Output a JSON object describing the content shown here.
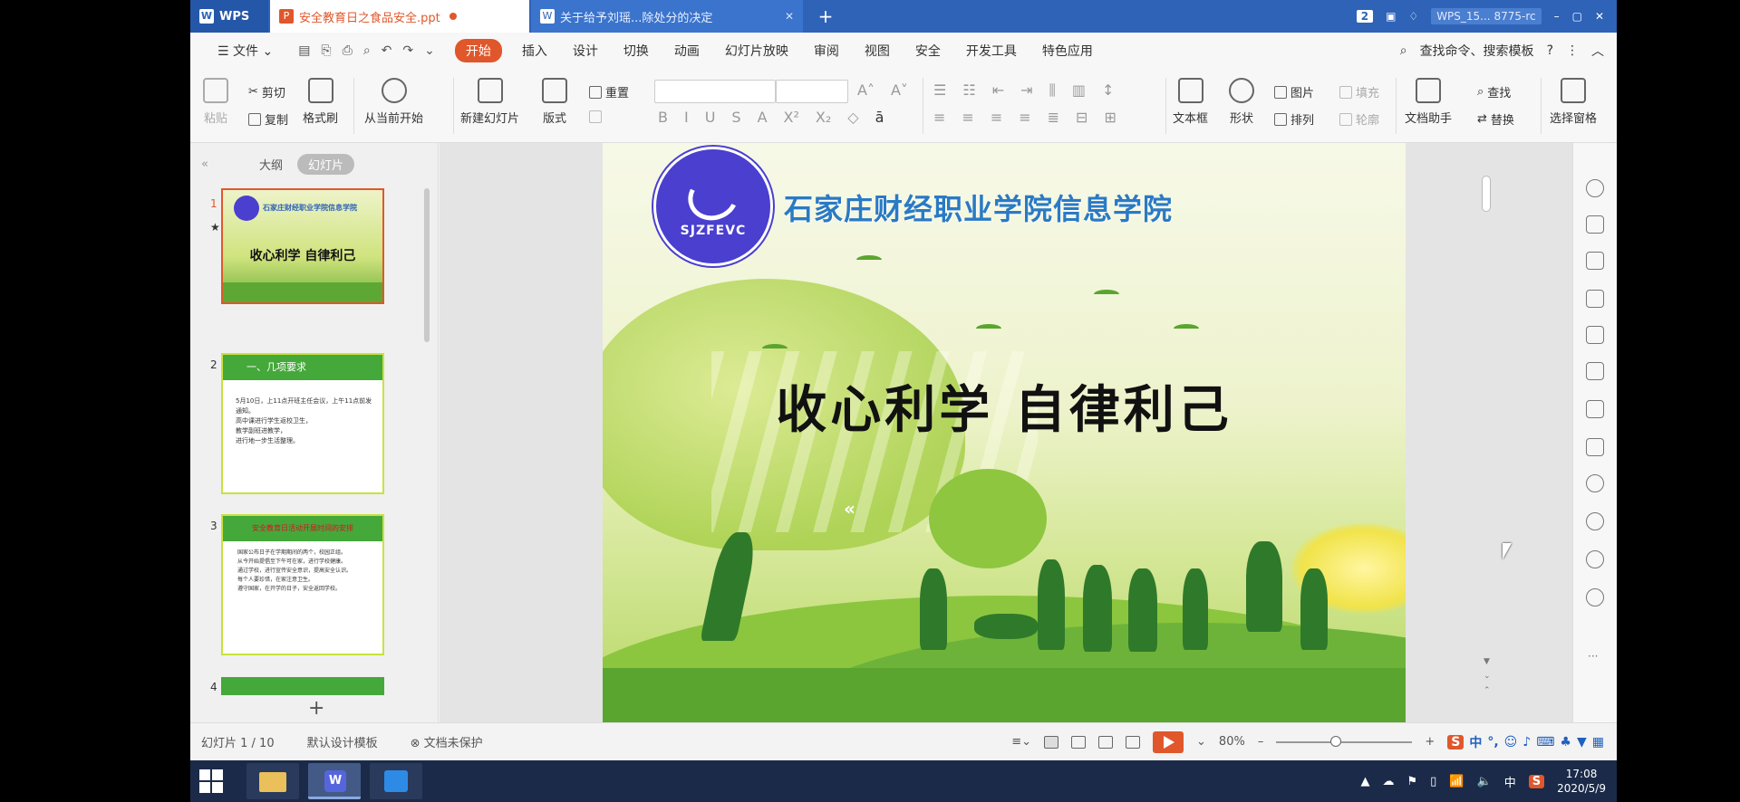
{
  "titlebar": {
    "app_tab": "WPS",
    "active_doc": "安全教育日之食品安全.ppt",
    "second_doc": "关于给予刘瑶...除处分的决定",
    "new_tab": "+",
    "window_count": "2",
    "user_label": "WPS_15...",
    "user_id": "8775-rc",
    "minimize": "–",
    "maximize": "▢",
    "close": "✕"
  },
  "menubar": {
    "file": "☰ 文件 ⌄",
    "items": [
      "开始",
      "插入",
      "设计",
      "切换",
      "动画",
      "幻灯片放映",
      "审阅",
      "视图",
      "安全",
      "开发工具",
      "特色应用"
    ],
    "search": "查找命令、搜索模板",
    "help": "?"
  },
  "ribbon": {
    "paste": "粘贴",
    "cut": "剪切",
    "copy": "复制",
    "format_painter": "格式刷",
    "from_current": "从当前开始",
    "new_slide": "新建幻灯片",
    "layout": "版式",
    "reset": "重置",
    "text_box": "文本框",
    "shape": "形状",
    "picture": "图片",
    "arrange": "排列",
    "fill": "填充",
    "outline": "轮廓",
    "doc_assistant": "文档助手",
    "find": "查找",
    "replace": "替换",
    "select_pane": "选择窗格"
  },
  "left_panel": {
    "collapse": "«",
    "tab_outline": "大纲",
    "tab_slides": "幻灯片",
    "thumbs": [
      {
        "num": "1",
        "title": "收心利学 自律利己",
        "school": "石家庄财经职业学院信息学院"
      },
      {
        "num": "2",
        "title": "一、几项要求",
        "lines": [
          "5月10日，上11点开班主任会议，上午11点前发通知。",
          "高中课进行学生返校卫生，",
          "教学副班进教学，",
          "进行地一步生活整理。"
        ]
      },
      {
        "num": "3",
        "title": "安全教育日活动开展时间的安排",
        "lines": [
          "国家公布日子在学期期间的两个，校园正组。",
          "从今开始提倡至下午可在家，进行学校健康。",
          "通过学校，进行宣传安全意识，提高安全认识。",
          "每个人要珍惜，在家注意卫生。",
          "遵守国家，在开学的日子，安全返回学校。"
        ]
      },
      {
        "num": "4"
      }
    ],
    "add": "+"
  },
  "slide": {
    "school_name": "石家庄财经职业学院信息学院",
    "logo_abbr": "SJZFEVC",
    "title": "收心利学 自律利己",
    "chevron": "«"
  },
  "statusbar": {
    "slide_count": "幻灯片 1 / 10",
    "template": "默认设计模板",
    "protection": "文档未保护",
    "zoom": "80%",
    "zoom_minus": "–",
    "zoom_plus": "+"
  },
  "ime": {
    "logo": "S",
    "mode": "中",
    "punct": "°,"
  },
  "taskbar": {
    "time": "17:08",
    "date": "2020/5/9",
    "lang": "中",
    "app_logo": "S"
  }
}
